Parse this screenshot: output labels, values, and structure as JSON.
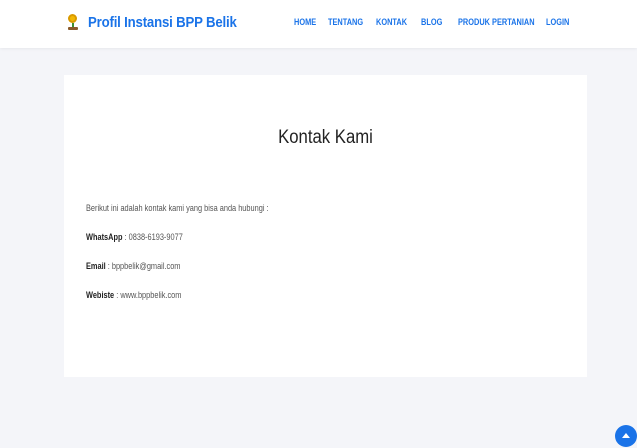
{
  "header": {
    "brand": "Profil Instansi BPP Belik",
    "brand_icon": "flower-pot-icon",
    "nav": [
      {
        "label": "HOME"
      },
      {
        "label": "TENTANG"
      },
      {
        "label": "KONTAK"
      },
      {
        "label": "BLOG"
      },
      {
        "label": "PRODUK PERTANIAN"
      },
      {
        "label": "LOGIN"
      }
    ]
  },
  "main": {
    "title": "Kontak Kami",
    "intro": "Berikut ini adalah kontak kami yang bisa anda hubungi :",
    "contacts": {
      "whatsapp": {
        "label": "WhatsApp",
        "value": " : 0838-6193-9077"
      },
      "email": {
        "label": "Email",
        "value": " : bppbelik@gmail.com"
      },
      "website": {
        "label": "Webiste",
        "value": " : www.bppbelik.com"
      }
    }
  },
  "back_to_top_icon": "chevron-up-icon",
  "colors": {
    "accent": "#1a73e8",
    "page_background": "#f4f5f9",
    "card_background": "#ffffff"
  }
}
